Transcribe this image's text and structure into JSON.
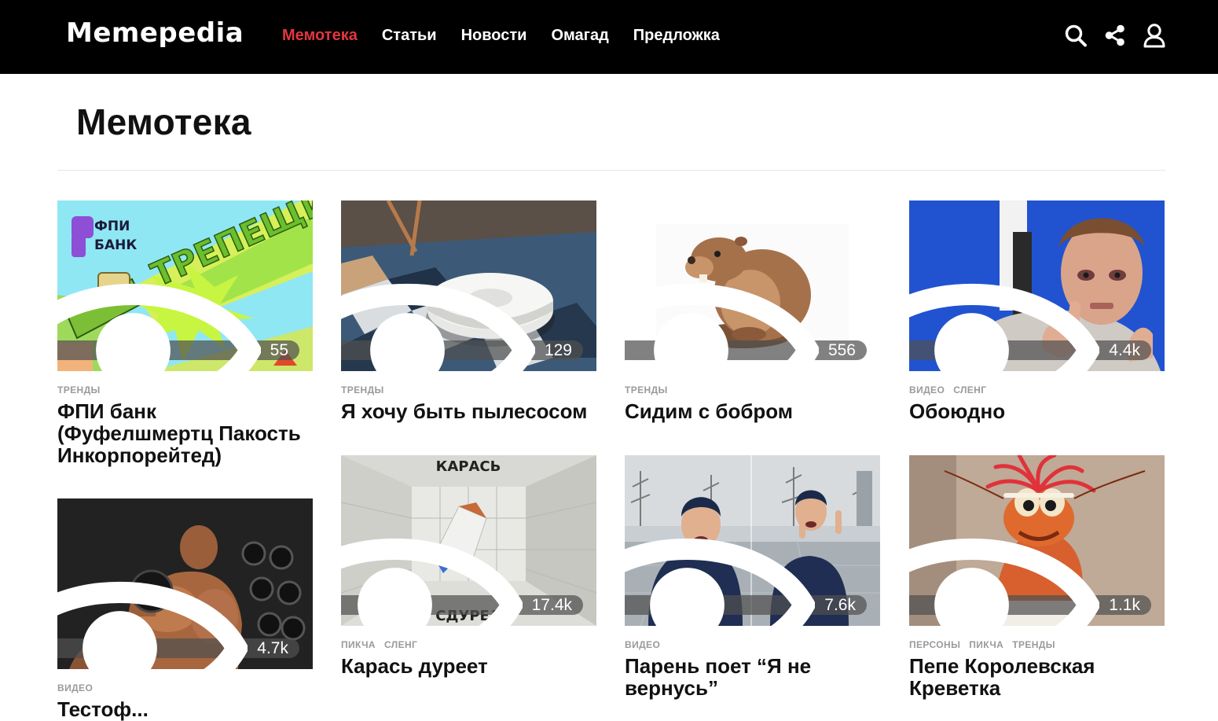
{
  "header": {
    "logo": "Memepedia",
    "nav": [
      {
        "label": "Мемотека",
        "active": true
      },
      {
        "label": "Статьи",
        "active": false
      },
      {
        "label": "Новости",
        "active": false
      },
      {
        "label": "Омагад",
        "active": false
      },
      {
        "label": "Предложка",
        "active": false
      }
    ],
    "icons": [
      "search-icon",
      "share-icon",
      "user-icon"
    ]
  },
  "page": {
    "title": "Мемотека"
  },
  "colors": {
    "accent": "#e0373f",
    "header_bg": "#000000",
    "tag": "#9a9a9a"
  },
  "cards": [
    {
      "title": "ФПИ банк (Фуфелшмертц Пакость Инкорпорейтед)",
      "tags": [
        "ТРЕНДЫ"
      ],
      "views": "55",
      "image": "fpi-bank-meme"
    },
    {
      "title": "Я хочу быть пылесосом",
      "tags": [
        "ТРЕНДЫ"
      ],
      "views": "129",
      "image": "robot-vacuum"
    },
    {
      "title": "Сидим с бобром",
      "tags": [
        "ТРЕНДЫ"
      ],
      "views": "556",
      "image": "beaver-emoji"
    },
    {
      "title": "Обоюдно",
      "tags": [
        "ВИДЕО",
        "СЛЕНГ"
      ],
      "views": "4.4k",
      "image": "man-thumbs-up"
    },
    {
      "title": "Тестоф...",
      "tags": [
        "ВИДЕО"
      ],
      "views": "4.7k",
      "image": "bodybuilder"
    },
    {
      "title": "Карась дуреет",
      "tags": [
        "ПИКЧА",
        "СЛЕНГ"
      ],
      "views": "17.4k",
      "image": "padded-room",
      "image_caption_top": "КАРАСЬ",
      "image_caption_bottom": "СДУРЕЛ"
    },
    {
      "title": "Парень поет “Я не вернусь”",
      "tags": [
        "ВИДЕО"
      ],
      "views": "7.6k",
      "image": "singing-guy"
    },
    {
      "title": "Пепе Королевская Креветка",
      "tags": [
        "ПЕРСОНЫ",
        "ПИКЧА",
        "ТРЕНДЫ"
      ],
      "views": "1.1k",
      "image": "pepe-prawn"
    }
  ]
}
